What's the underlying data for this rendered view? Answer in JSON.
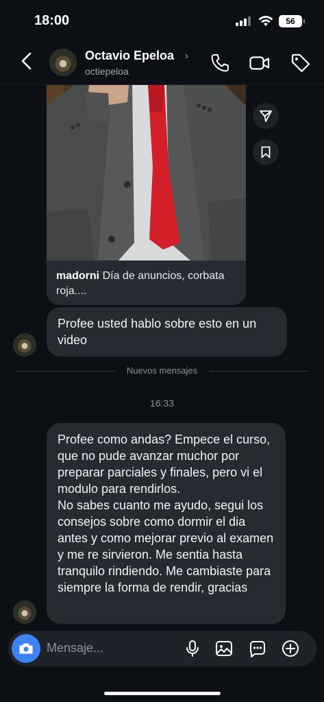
{
  "status_bar": {
    "time": "18:00",
    "battery": "56"
  },
  "header": {
    "name": "Octavio Epeloa",
    "handle": "octiepeloa"
  },
  "shared_post": {
    "author": "madorni",
    "caption": "Día de anuncios, corbata roja...."
  },
  "messages": [
    {
      "text": "Profee usted hablo sobre esto en un video"
    },
    {
      "text": "Profee como andas? Empece el curso, que no pude avanzar muchor por preparar parciales y finales, pero vi el modulo para rendirlos.\nNo sabes cuanto me ayudo, segui los consejos sobre como dormir el dia antes y como mejorar previo al examen y me re sirvieron. Me sentia hasta tranquilo rindiendo. Me cambiaste para siempre la forma de rendir, gracias"
    }
  ],
  "divider_label": "Nuevos mensajes",
  "timestamp": "16:33",
  "composer": {
    "placeholder": "Mensaje..."
  },
  "colors": {
    "background": "#0c0f14",
    "bubble": "#262a31",
    "accent": "#3d83f5",
    "tie": "#d31f2a"
  },
  "icons": [
    "back-icon",
    "chevron-right-icon",
    "phone-icon",
    "video-icon",
    "tag-icon",
    "send-icon",
    "bookmark-icon",
    "camera-icon",
    "mic-icon",
    "gallery-icon",
    "sticker-icon",
    "plus-icon"
  ]
}
